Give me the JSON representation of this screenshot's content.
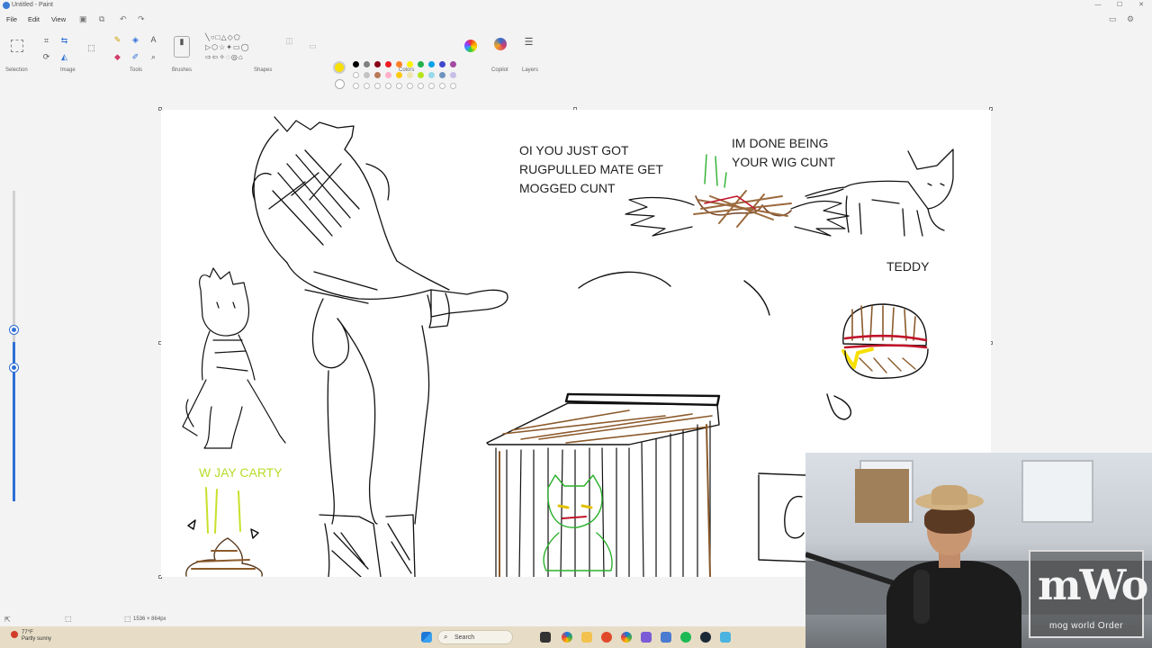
{
  "window": {
    "title": "Untitled - Paint",
    "controls": [
      "—",
      "☐",
      "✕"
    ]
  },
  "menu": {
    "file": "File",
    "edit": "Edit",
    "view": "View"
  },
  "ribbon": {
    "groups": [
      "Selection",
      "Image",
      "Tools",
      "Brushes",
      "Shapes",
      "Colors",
      "Copilot",
      "Layers"
    ],
    "primary_color": "#f7e000",
    "palette_row1": [
      "#000000",
      "#7f7f7f",
      "#880015",
      "#ed1c24",
      "#ff7f27",
      "#fff200",
      "#22b14c",
      "#00a2e8",
      "#3f48cc",
      "#a349a4"
    ],
    "palette_row2": [
      "#ffffff",
      "#c3c3c3",
      "#b97a57",
      "#ffaec9",
      "#ffc90e",
      "#efe4b0",
      "#b5e61d",
      "#99d9ea",
      "#7092be",
      "#c8bfe7"
    ]
  },
  "canvas_texts": {
    "oi": "OI YOU JUST GOT\nRUGPULLED MATE GET\nMOGGED CUNT",
    "done": "IM DONE BEING\nYOUR WIG CUNT",
    "teddy": "TEDDY",
    "wjay": "W JAY CARTY"
  },
  "status": {
    "dimensions": "1536 × 864px"
  },
  "taskbar": {
    "weather_temp": "77°F",
    "weather_desc": "Partly sunny",
    "search": "Search"
  },
  "webcam": {
    "logo_main": "mWo",
    "logo_sub": "mog world Order"
  }
}
